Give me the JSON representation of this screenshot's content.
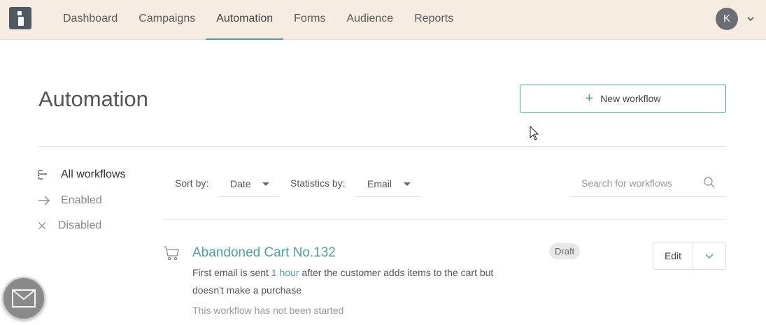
{
  "nav": {
    "items": [
      {
        "label": "Dashboard"
      },
      {
        "label": "Campaigns"
      },
      {
        "label": "Automation",
        "active": true
      },
      {
        "label": "Forms"
      },
      {
        "label": "Audience"
      },
      {
        "label": "Reports"
      }
    ],
    "avatar_initial": "K"
  },
  "header": {
    "title": "Automation",
    "new_workflow_label": "New workflow"
  },
  "sidebar": {
    "items": [
      {
        "label": "All workflows",
        "icon": "workflow-icon"
      },
      {
        "label": "Enabled",
        "icon": "arrow-right-icon"
      },
      {
        "label": "Disabled",
        "icon": "close-icon"
      }
    ]
  },
  "filters": {
    "sort_label": "Sort by:",
    "sort_value": "Date",
    "stats_label": "Statistics by:",
    "stats_value": "Email",
    "search_placeholder": "Search for workflows"
  },
  "workflow": {
    "title": "Abandoned Cart No.132",
    "desc_before": "First email is sent ",
    "desc_highlight": "1 hour",
    "desc_after": " after the customer adds items to the cart but doesn't make a purchase",
    "status": "This workflow has not been started",
    "badge": "Draft",
    "edit_label": "Edit"
  },
  "colors": {
    "accent": "#4aa3a2",
    "topbar": "#f6ece1"
  }
}
